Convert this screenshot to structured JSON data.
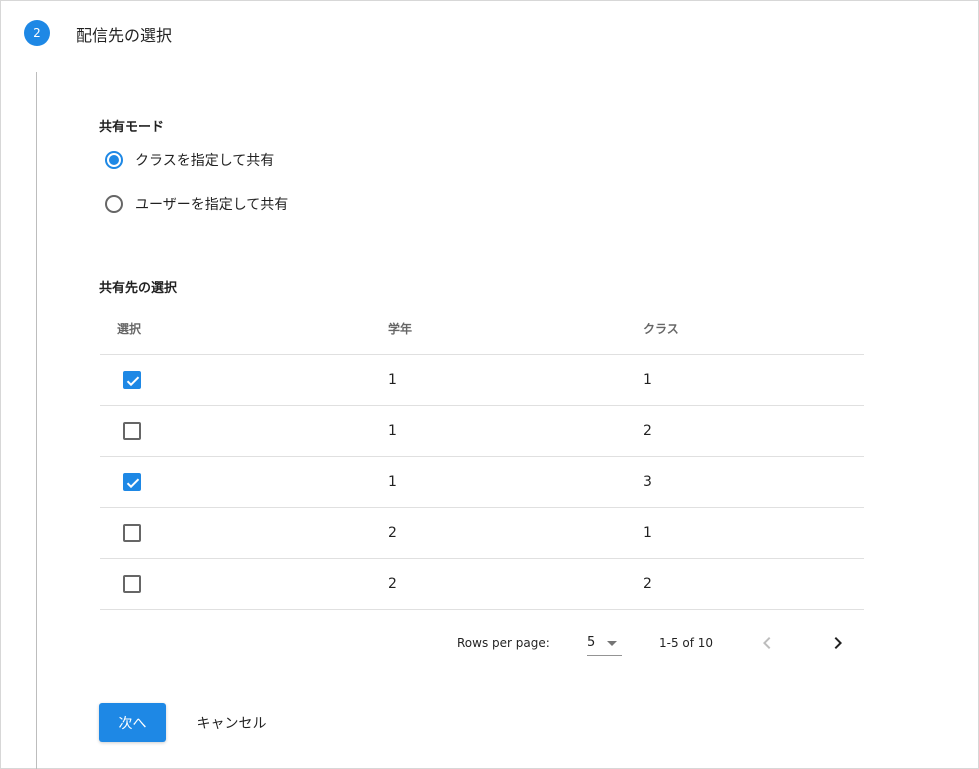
{
  "colors": {
    "accent": "#1e88e5"
  },
  "step": {
    "number": "2",
    "title": "配信先の選択"
  },
  "share_mode": {
    "label": "共有モード",
    "options": [
      {
        "label": "クラスを指定して共有",
        "selected": true
      },
      {
        "label": "ユーザーを指定して共有",
        "selected": false
      }
    ]
  },
  "targets": {
    "label": "共有先の選択",
    "columns": [
      "選択",
      "学年",
      "クラス"
    ],
    "rows": [
      {
        "checked": true,
        "grade": "1",
        "class": "1"
      },
      {
        "checked": false,
        "grade": "1",
        "class": "2"
      },
      {
        "checked": true,
        "grade": "1",
        "class": "3"
      },
      {
        "checked": false,
        "grade": "2",
        "class": "1"
      },
      {
        "checked": false,
        "grade": "2",
        "class": "2"
      }
    ]
  },
  "pagination": {
    "rows_per_page_label": "Rows per page:",
    "rows_per_page_value": "5",
    "range": "1-5 of 10",
    "prev_icon": "chevron-left-icon",
    "next_icon": "chevron-right-icon"
  },
  "actions": {
    "next_label": "次へ",
    "cancel_label": "キャンセル"
  }
}
